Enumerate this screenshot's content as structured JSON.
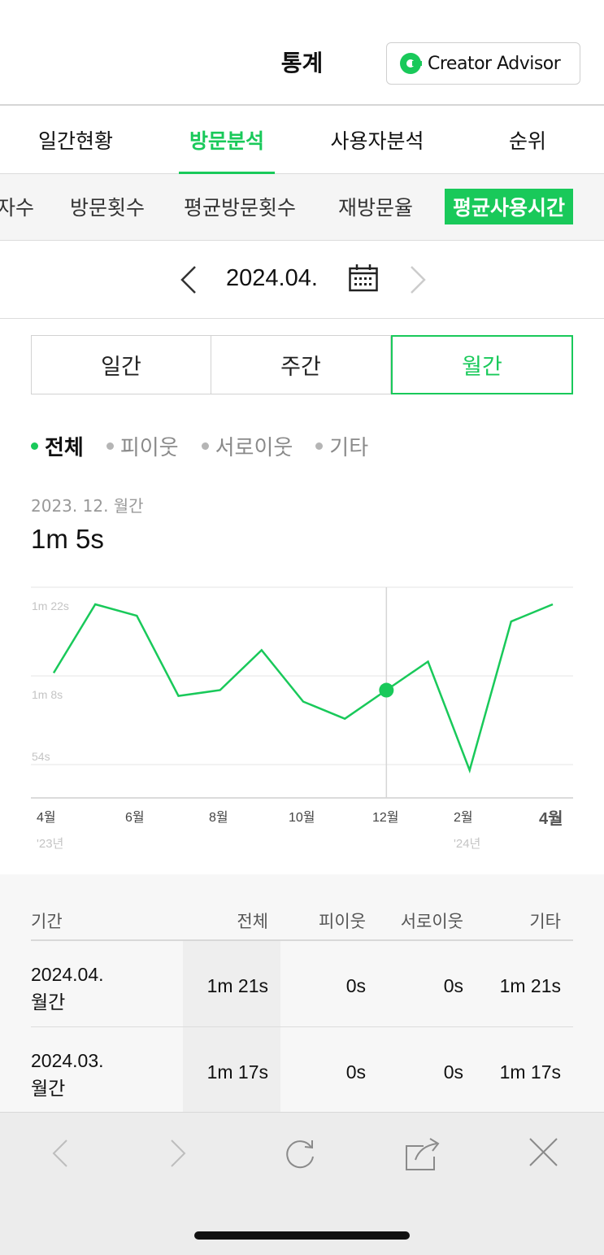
{
  "header": {
    "title": "통계",
    "creator_advisor": "Creator Advisor"
  },
  "tabs": [
    {
      "label": "일간현황",
      "active": false
    },
    {
      "label": "방문분석",
      "active": true
    },
    {
      "label": "사용자분석",
      "active": false
    },
    {
      "label": "순위",
      "active": false
    }
  ],
  "subtabs": [
    {
      "label": "자수"
    },
    {
      "label": "방문횟수"
    },
    {
      "label": "평균방문횟수"
    },
    {
      "label": "재방문율"
    },
    {
      "label": "평균사용시간",
      "active": true
    }
  ],
  "date_nav": {
    "date": "2024.04."
  },
  "period": {
    "daily": "일간",
    "weekly": "주간",
    "monthly": "월간",
    "selected": "monthly"
  },
  "filters": [
    {
      "label": "전체",
      "active": true
    },
    {
      "label": "피이웃"
    },
    {
      "label": "서로이웃"
    },
    {
      "label": "기타"
    }
  ],
  "summary": {
    "label": "2023. 12. 월간",
    "value": "1m 5s"
  },
  "chart_data": {
    "type": "line",
    "x": [
      "2023-04",
      "2023-05",
      "2023-06",
      "2023-07",
      "2023-08",
      "2023-09",
      "2023-10",
      "2023-11",
      "2023-12",
      "2024-01",
      "2024-02",
      "2024-03",
      "2024-04"
    ],
    "y_seconds": [
      70,
      82,
      80,
      66,
      67,
      74,
      65,
      62,
      67,
      72,
      53,
      79,
      82
    ],
    "y_tick_labels": [
      "1m 22s",
      "1m 8s",
      "54s"
    ],
    "x_tick_labels": [
      "4월",
      "6월",
      "8월",
      "10월",
      "12월",
      "2월",
      "4월"
    ],
    "year_labels": [
      "'23년",
      "'24년"
    ],
    "highlight": "2023-12",
    "color": "#19c95a"
  },
  "table": {
    "headers": [
      "기간",
      "전체",
      "피이웃",
      "서로이웃",
      "기타"
    ],
    "rows": [
      {
        "period_date": "2024.04.",
        "period_type": "월간",
        "total": "1m 21s",
        "neighbor": "0s",
        "mutual": "0s",
        "other": "1m 21s"
      },
      {
        "period_date": "2024.03.",
        "period_type": "월간",
        "total": "1m 17s",
        "neighbor": "0s",
        "mutual": "0s",
        "other": "1m 17s"
      }
    ]
  },
  "toolbar": {
    "icons": [
      "back-icon",
      "forward-icon",
      "reload-icon",
      "share-icon",
      "close-icon"
    ]
  }
}
